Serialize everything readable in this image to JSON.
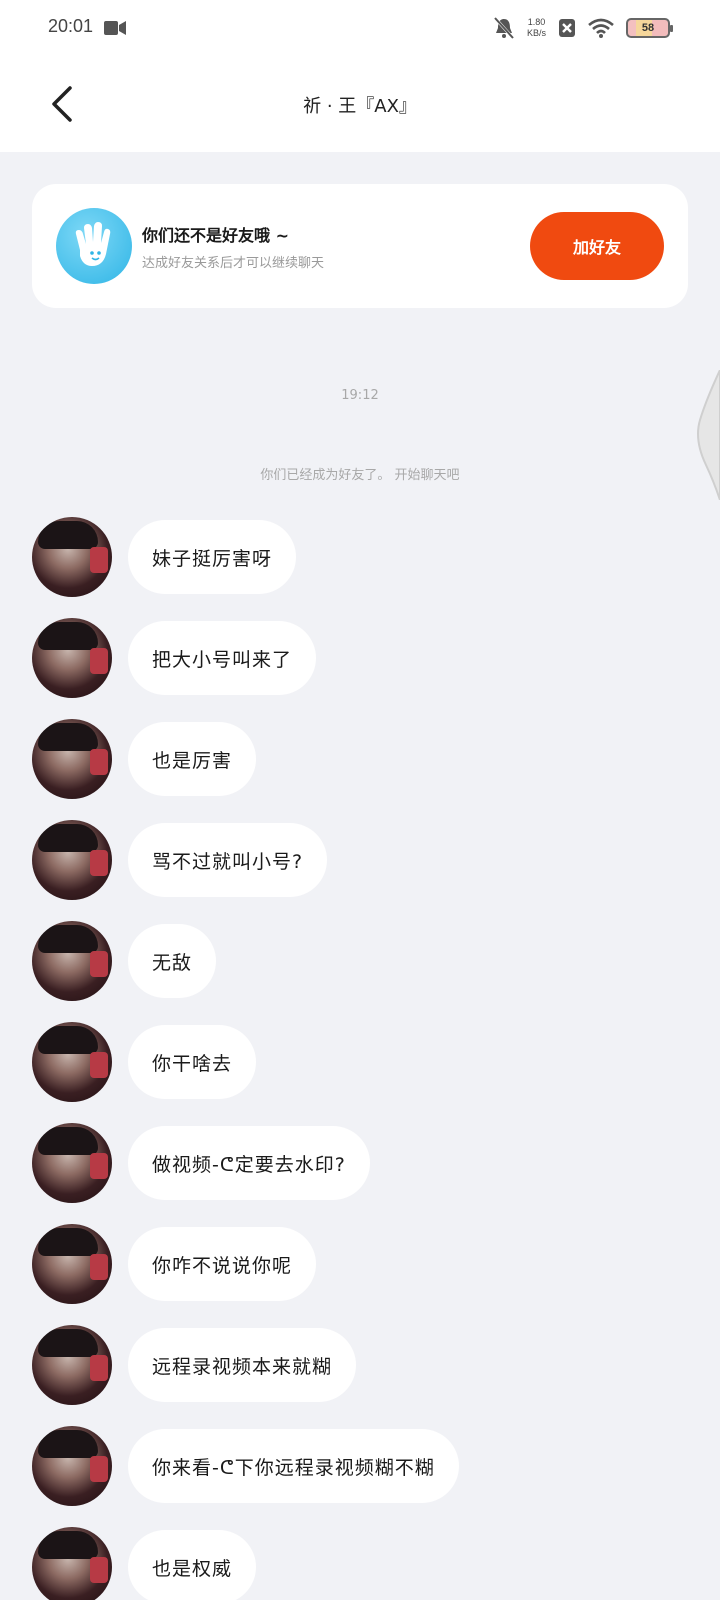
{
  "status_bar": {
    "time": "20:01",
    "speed_value": "1.80",
    "speed_unit": "KB/s",
    "battery": "58"
  },
  "header": {
    "title": "祈 · 王『AX』"
  },
  "friend_card": {
    "title": "你们还不是好友哦 ~",
    "subtitle": "达成好友关系后才可以继续聊天",
    "button_label": "加好友"
  },
  "chat": {
    "timestamp": "19:12",
    "system_notice": "你们已经成为好友了。 开始聊天吧",
    "messages": [
      "妹子挺厉害呀",
      "把大小号叫来了",
      "也是厉害",
      "骂不过就叫小号?",
      "无敌",
      "你干啥去",
      "做视频-ᕦ定要去水印?",
      "你咋不说说你呢",
      "远程录视频本来就糊",
      "你来看-ᕦ下你远程录视频糊不糊",
      "也是权威"
    ]
  },
  "colors": {
    "accent": "#f04a10",
    "background": "#f1f2f6",
    "bubble": "#ffffff"
  }
}
